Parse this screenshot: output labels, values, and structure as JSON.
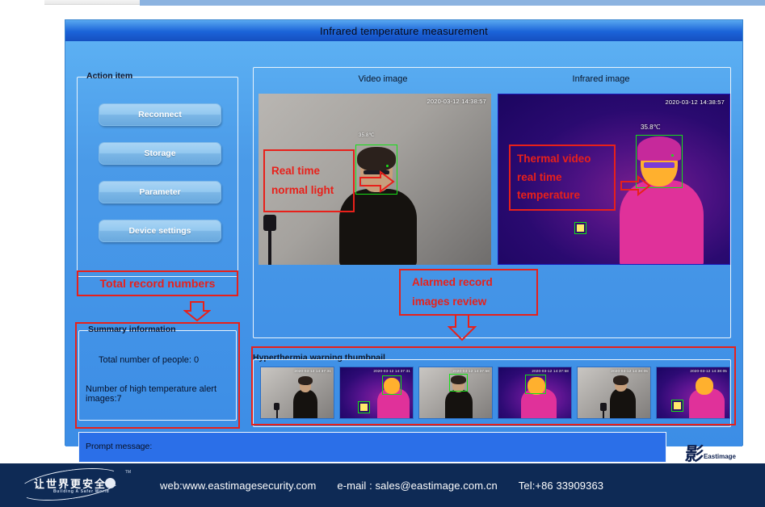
{
  "window": {
    "title": "Infrared temperature measurement"
  },
  "action_panel": {
    "group_title": "Action item",
    "buttons": [
      {
        "label": "Reconnect"
      },
      {
        "label": "Storage"
      },
      {
        "label": "Parameter"
      },
      {
        "label": "Device settings"
      }
    ]
  },
  "summary_panel": {
    "group_title": "Summary information",
    "lines": [
      "Total number of people:   0",
      "Number of high temperature alert images:7"
    ],
    "total_people": 0,
    "high_temp_alert_images": 7
  },
  "annotations": {
    "total_record_numbers": "Total record numbers",
    "real_time_normal_light": "Real time\nnormal light",
    "real_time_normal_light_l1": "Real time",
    "real_time_normal_light_l2": "normal light",
    "thermal_video_l1": "Thermal video",
    "thermal_video_l2": "real time",
    "thermal_video_l3": "temperature",
    "alarmed_l1": "Alarmed record",
    "alarmed_l2": "images review",
    "color": "#e8201a"
  },
  "video_panel": {
    "video_caption": "Video image",
    "infrared_caption": "Infrared image",
    "video_timestamp": "2020-03-12 14:38:57",
    "infrared_timestamp": "2020-03-12 14:38:57",
    "measured_temperature": "35.8℃",
    "detection_box_color": "#17e017"
  },
  "thumbnails": {
    "label": "Hyperthermia warning thumbnail",
    "items": [
      {
        "type": "visible",
        "timestamp": "2020-03-12 14:37:31"
      },
      {
        "type": "infrared",
        "timestamp": "2020-03-12 14:37:31"
      },
      {
        "type": "visible",
        "timestamp": "2020-03-12 14:37:58"
      },
      {
        "type": "infrared",
        "timestamp": "2020-03-12 14:37:58"
      },
      {
        "type": "visible",
        "timestamp": "2020-03-12 14:38:05"
      },
      {
        "type": "infrared",
        "timestamp": "2020-03-12 14:38:05"
      }
    ]
  },
  "prompt": {
    "label": "Prompt message:"
  },
  "inner_logo": {
    "mark": "影",
    "word": "Eastimage"
  },
  "footer": {
    "logo_cn": "让世界更安全",
    "logo_en": "Building A Safer World",
    "trademark": "TM",
    "web": "web:www.eastimagesecurity.com",
    "email": "e-mail : sales@eastimage.com.cn",
    "tel": "Tel:+86 33909363"
  },
  "theme": {
    "window_blue": "#4a9ae8",
    "title_blue": "#1b63d8",
    "footer_navy": "#0e2a55",
    "annotation_red": "#e8201a",
    "detect_green": "#17e017"
  }
}
